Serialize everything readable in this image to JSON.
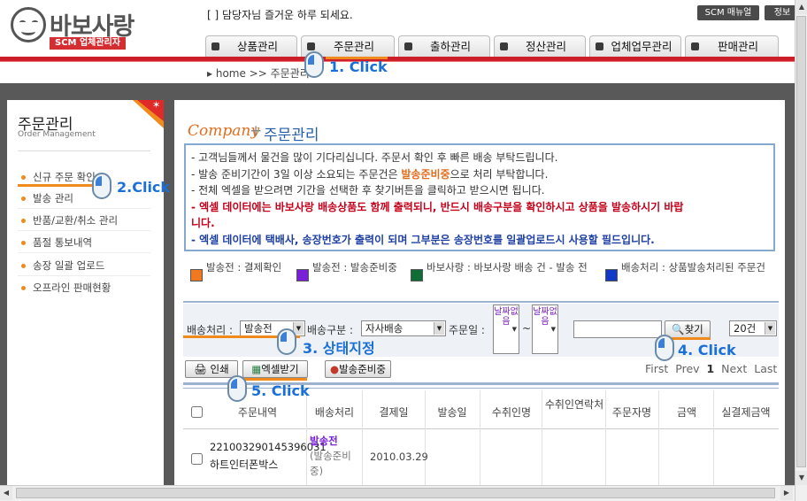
{
  "logo": {
    "brand": "바보사랑",
    "badge": "SCM 업체관리자"
  },
  "header": {
    "greeting": "[          ] 담당자님  즐거운 하루 되세요.",
    "scm_manual": "SCM 매뉴얼",
    "info": "정보"
  },
  "tabs": [
    "상품관리",
    "주문관리",
    "출하관리",
    "정산관리",
    "업체업무관리",
    "판매관리"
  ],
  "breadcrumb": "▸ home >> 주문관리",
  "annotations": {
    "a1": "1. Click",
    "a2": "2.Click",
    "a3": "3. 상태지정",
    "a4": "4. Click",
    "a5": "5. Click"
  },
  "sidebar": {
    "title": "주문관리",
    "subtitle": "Order Management",
    "items": [
      "신규 주문 확인",
      "발송 관리",
      "반품/교환/취소 관리",
      "품절 통보내역",
      "송장 일괄 업로드",
      "오프라인 판매현황"
    ]
  },
  "content": {
    "title_en": "Company",
    "title_plus": "+",
    "title_ko": "주문관리",
    "notice": {
      "line1": "- 고객님들께서 물건을 많이 기다리십니다. 주문서 확인 후 빠른 배송 부탁드립니다.",
      "line2_a": "- 발송 준비기간이 3일 이상 소요되는 주문건은 ",
      "line2_b": "발송준비중",
      "line2_c": "으로 처리 부탁합니다.",
      "line3": "- 전체 엑셀을 받으려면 기간을 선택한 후 찾기버튼을 클릭하고 받으시면 됩니다.",
      "line4a": "- 엑셀 데이터에는 바보사랑 배송상품도 함께 출력되니, 반드시 배송구분을 확인하시고 상품을 발송하시기 바랍",
      "line4b": "니다.",
      "line5": "- 엑셀 데이터에 택배사, 송장번호가 출력이 되며 그부분은 송장번호를 일괄업로드시 사용할 필드입니다."
    },
    "legend": [
      {
        "label": "발송전 : 결제확인",
        "color": "#f07820"
      },
      {
        "label": "발송전 : 발송준비중",
        "color": "#7a1fd8"
      },
      {
        "label": "바보사랑 : 바보사랑 배송 건 - 발송 전",
        "color": "#0f6e35"
      },
      {
        "label": "배송처리 : 상품발송처리된 주문건",
        "color": "#1238c8"
      }
    ],
    "filters": {
      "delivery_label": "배송처리 :",
      "delivery_value": "발송전",
      "type_label": "배송구분 :",
      "type_value": "자사배송",
      "date_label": "주문일 :",
      "date_from": "날짜없음",
      "tilde": "~",
      "date_to": "날짜없음",
      "search_value": "",
      "find_btn": "찾기",
      "count_value": "20건"
    },
    "actions": {
      "print": "인쇄",
      "excel": "엑셀받기",
      "ready": "발송준비중"
    },
    "pager": {
      "first": "First",
      "prev": "Prev",
      "page": "1",
      "next": "Next",
      "last": "Last"
    },
    "table": {
      "headers": [
        "주문내역",
        "배송처리",
        "결제일",
        "발송일",
        "수취인명",
        "수취인연락처",
        "주문자명",
        "금액",
        "실결제금액"
      ],
      "row": {
        "order_no": "221003290145396031",
        "product": "하트인터폰박스",
        "status": "발송전",
        "status_sub": "(발송준비중)",
        "pay_date": "2010.03.29"
      }
    }
  }
}
